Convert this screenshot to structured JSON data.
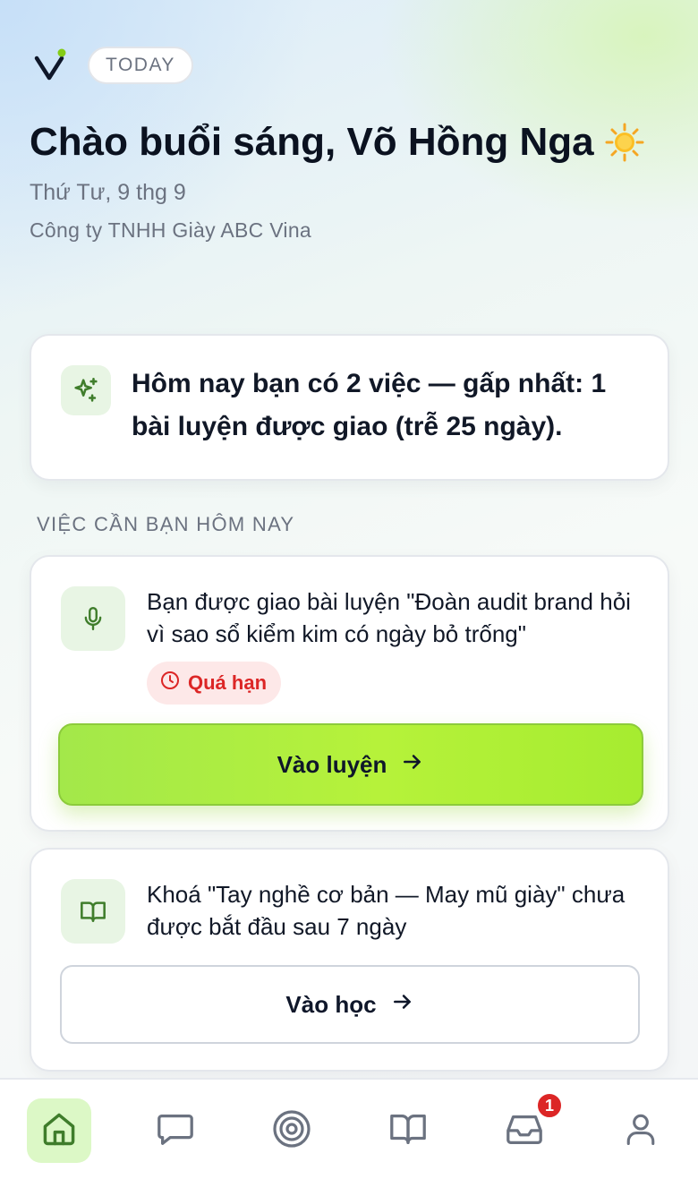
{
  "header": {
    "logo_icon": "v-logo-icon",
    "today_chip": "TODAY",
    "greeting": "Chào buổi sáng, Võ Hồng Nga",
    "greeting_icon": "sun-icon",
    "date": "Thứ Tư, 9 thg 9",
    "company": "Công ty TNHH Giày ABC Vina"
  },
  "summary": {
    "icon": "sparkles-icon",
    "text": "Hôm nay bạn có 2 việc — gấp nhất: 1 bài luyện được giao (trễ 25 ngày)."
  },
  "section_label": "VIỆC CẦN BẠN HÔM NAY",
  "tasks": [
    {
      "icon": "microphone-icon",
      "text": "Bạn được giao bài luyện \"Đoàn audit brand hỏi vì sao sổ kiểm kim có ngày bỏ trống\"",
      "badge": "Quá hạn",
      "badge_icon": "clock-icon",
      "button_label": "Vào luyện",
      "button_icon": "arrow-right-icon"
    },
    {
      "icon": "book-open-icon",
      "text": "Khoá \"Tay nghề cơ bản — May mũ giày\" chưa được bắt đầu sau 7 ngày",
      "button_label": "Vào học",
      "button_icon": "arrow-right-icon"
    }
  ],
  "bottom_nav": {
    "items": [
      {
        "icon": "home-icon",
        "active": true
      },
      {
        "icon": "chat-icon",
        "active": false
      },
      {
        "icon": "target-icon",
        "active": false
      },
      {
        "icon": "book-icon",
        "active": false
      },
      {
        "icon": "inbox-icon",
        "active": false,
        "badge": "1"
      },
      {
        "icon": "user-icon",
        "active": false
      }
    ],
    "inbox_badge": "1"
  },
  "colors": {
    "accent_green": "#b6f23a",
    "overdue_red": "#dc2626",
    "icon_green": "#3f7d2b"
  }
}
